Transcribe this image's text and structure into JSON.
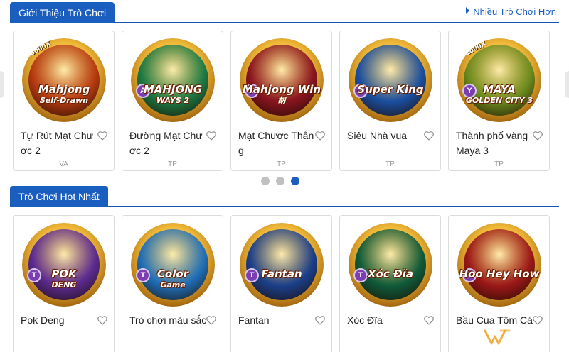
{
  "sections": {
    "intro": {
      "title": "Giới Thiệu Trò Chơi",
      "more_link": "Nhiều Trò Chơi Hơn",
      "games": [
        {
          "name": "Tự Rút Mạt Chược 2",
          "provider": "VA",
          "art_title": "Mahjong",
          "art_sub": "Self-Drawn",
          "badge": "",
          "multiplier": "3000X",
          "inner_color": "#b53a12"
        },
        {
          "name": "Đường Mạt Chược 2",
          "provider": "TP",
          "art_title": "MAHJONG",
          "art_sub": "WAYS 2",
          "badge": "A",
          "multiplier": "",
          "inner_color": "#1c7a44"
        },
        {
          "name": "Mạt Chược Thắng",
          "provider": "TP",
          "art_title": "Mahjong Win",
          "art_sub": "胡",
          "badge": "D",
          "multiplier": "",
          "inner_color": "#8a1520"
        },
        {
          "name": "Siêu Nhà vua",
          "provider": "TP",
          "art_title": "Super King",
          "art_sub": "",
          "badge": "T",
          "multiplier": "",
          "inner_color": "#1b4fa0"
        },
        {
          "name": "Thành phố vàng Maya 3",
          "provider": "TP",
          "art_title": "MAYA",
          "art_sub": "GOLDEN CITY 3",
          "badge": "Y",
          "multiplier": "1000X",
          "inner_color": "#6b8a1e"
        }
      ]
    },
    "hot": {
      "title": "Trò Chơi Hot Nhất",
      "games": [
        {
          "name": "Pok Deng",
          "provider": "",
          "art_title": "POK",
          "art_sub": "DENG",
          "badge": "T",
          "multiplier": "",
          "inner_color": "#5b2b91"
        },
        {
          "name": "Trò chơi màu sắc",
          "provider": "",
          "art_title": "Color",
          "art_sub": "Game",
          "badge": "T",
          "multiplier": "",
          "inner_color": "#1f6fb8"
        },
        {
          "name": "Fantan",
          "provider": "",
          "art_title": "Fantan",
          "art_sub": "",
          "badge": "T",
          "multiplier": "",
          "inner_color": "#1b3f8a"
        },
        {
          "name": "Xóc Đĩa",
          "provider": "",
          "art_title": "Xóc Đĩa",
          "art_sub": "",
          "badge": "T",
          "multiplier": "",
          "inner_color": "#0f5a3a"
        },
        {
          "name": "Bầu Cua Tôm Cá",
          "provider": "",
          "art_title": "Hoo Hey How",
          "art_sub": "",
          "badge": "T",
          "multiplier": "",
          "inner_color": "#9a1818"
        }
      ]
    }
  },
  "carousel": {
    "dots": 3,
    "active_index": 2
  },
  "colors": {
    "accent": "#1a5fbf",
    "dot_inactive": "#c0c0c0",
    "provider_text": "#9a9a9a"
  },
  "icons": {
    "card_favorite": "heart-outline-icon",
    "more_link": "triangle-right-icon"
  }
}
